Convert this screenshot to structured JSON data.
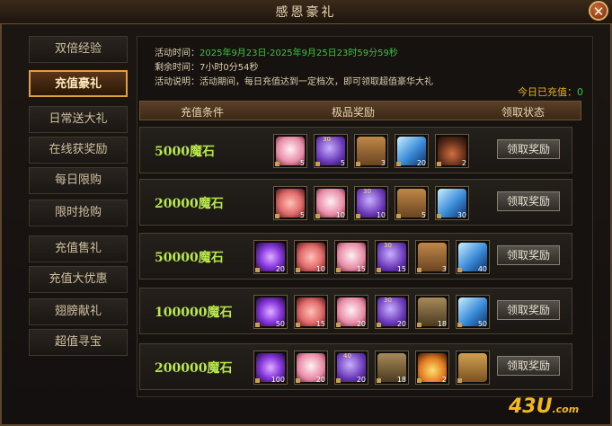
{
  "window": {
    "title": "感恩豪礼",
    "close_label": "✕"
  },
  "sidebar": {
    "items": [
      {
        "label": "双倍经验",
        "active": false
      },
      {
        "label": "充值豪礼",
        "active": true
      },
      {
        "label": "日常送大礼",
        "active": false
      },
      {
        "label": "在线获奖励",
        "active": false
      },
      {
        "label": "每日限购",
        "active": false
      },
      {
        "label": "限时抢购",
        "active": false
      },
      {
        "label": "充值售礼",
        "active": false
      },
      {
        "label": "充值大优惠",
        "active": false
      },
      {
        "label": "翅膀献礼",
        "active": false
      },
      {
        "label": "超值寻宝",
        "active": false
      }
    ]
  },
  "info": {
    "time_label": "活动时间：",
    "time_value": "2025年9月23日-2025年9月25日23时59分59秒",
    "remain_label": "剩余时间：",
    "remain_value": "7小时0分54秒",
    "desc_label": "活动说明：",
    "desc_value": "活动期间，每日充值达到一定档次，即可领取超值豪华大礼"
  },
  "recharged": {
    "label": "今日已充值：",
    "value": "0"
  },
  "table": {
    "col_condition": "充值条件",
    "col_rewards": "极品奖励",
    "col_status": "领取状态",
    "claim_label": "领取奖励",
    "rows": [
      {
        "condition": "5000魔石",
        "items": [
          {
            "icon": "fox-pet-icon",
            "count": "5",
            "tag": ""
          },
          {
            "icon": "purple-egg-icon",
            "count": "5",
            "tag": "30"
          },
          {
            "icon": "skill-book-icon",
            "count": "3",
            "tag": ""
          },
          {
            "icon": "blue-crystal-icon",
            "count": "20",
            "tag": ""
          },
          {
            "icon": "medal-icon",
            "count": "2",
            "tag": ""
          }
        ]
      },
      {
        "condition": "20000魔石",
        "items": [
          {
            "icon": "wing-feather-icon",
            "count": "5",
            "tag": ""
          },
          {
            "icon": "fox-pet-icon",
            "count": "10",
            "tag": ""
          },
          {
            "icon": "purple-egg-icon",
            "count": "10",
            "tag": "30"
          },
          {
            "icon": "skill-book-icon",
            "count": "5",
            "tag": ""
          },
          {
            "icon": "blue-crystal-icon",
            "count": "30",
            "tag": ""
          }
        ]
      },
      {
        "condition": "50000魔石",
        "items": [
          {
            "icon": "purple-orb-icon",
            "count": "20",
            "tag": ""
          },
          {
            "icon": "wing-feather-icon",
            "count": "10",
            "tag": ""
          },
          {
            "icon": "fox-pet-icon",
            "count": "15",
            "tag": ""
          },
          {
            "icon": "purple-egg-icon",
            "count": "15",
            "tag": "30"
          },
          {
            "icon": "skill-book-icon",
            "count": "3",
            "tag": ""
          },
          {
            "icon": "blue-crystal-icon",
            "count": "40",
            "tag": ""
          }
        ]
      },
      {
        "condition": "100000魔石",
        "items": [
          {
            "icon": "purple-orb-icon",
            "count": "50",
            "tag": ""
          },
          {
            "icon": "wing-feather-icon",
            "count": "15",
            "tag": ""
          },
          {
            "icon": "fox-pet-icon",
            "count": "20",
            "tag": ""
          },
          {
            "icon": "purple-egg-icon",
            "count": "20",
            "tag": "30"
          },
          {
            "icon": "ancient-tome-icon",
            "count": "18",
            "tag": ""
          },
          {
            "icon": "blue-crystal-icon",
            "count": "50",
            "tag": ""
          }
        ]
      },
      {
        "condition": "200000魔石",
        "items": [
          {
            "icon": "purple-orb-icon",
            "count": "100",
            "tag": ""
          },
          {
            "icon": "fox-pet-icon",
            "count": "20",
            "tag": ""
          },
          {
            "icon": "purple-egg-icon",
            "count": "20",
            "tag": "40"
          },
          {
            "icon": "ancient-tome-icon",
            "count": "18",
            "tag": ""
          },
          {
            "icon": "flame-gem-icon",
            "count": "2",
            "tag": ""
          },
          {
            "icon": "treasure-scroll-icon",
            "count": "",
            "tag": ""
          }
        ]
      }
    ]
  },
  "watermark": {
    "text": "43U",
    "suffix": ".com"
  }
}
